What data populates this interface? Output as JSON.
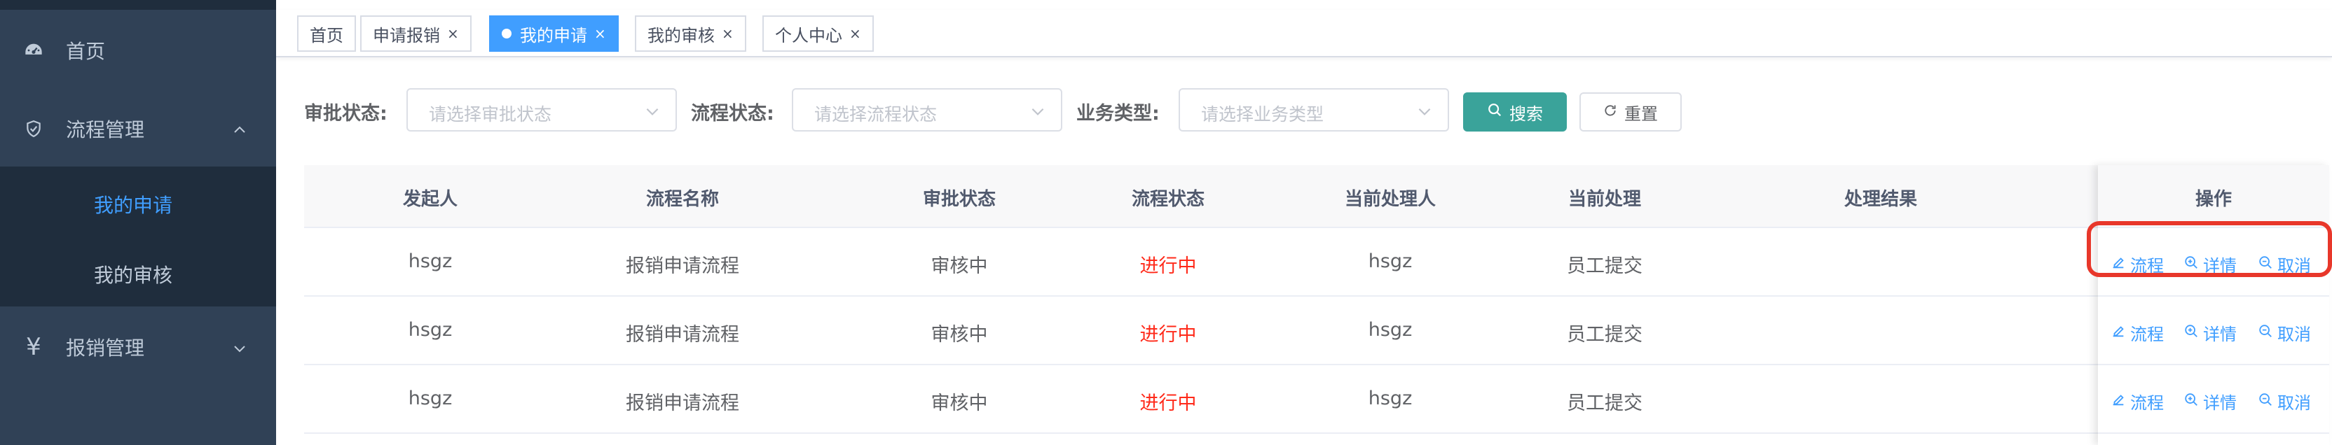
{
  "sidebar": {
    "items": [
      {
        "label": "首页",
        "icon": "dashboard-icon"
      },
      {
        "label": "流程管理",
        "icon": "shield-icon",
        "expanded": true,
        "children": [
          {
            "label": "我的申请",
            "active": true
          },
          {
            "label": "我的审核",
            "active": false
          }
        ]
      },
      {
        "label": "报销管理",
        "icon": "yen-icon",
        "expanded": false
      }
    ],
    "yen_symbol": "¥"
  },
  "tags": [
    {
      "label": "首页",
      "closable": false,
      "active": false
    },
    {
      "label": "申请报销",
      "closable": true,
      "active": false
    },
    {
      "label": "我的申请",
      "closable": true,
      "active": true
    },
    {
      "label": "我的审核",
      "closable": true,
      "active": false
    },
    {
      "label": "个人中心",
      "closable": true,
      "active": false
    }
  ],
  "tag_close": "×",
  "filters": {
    "approval_status": {
      "label": "审批状态:",
      "placeholder": "请选择审批状态"
    },
    "process_status": {
      "label": "流程状态:",
      "placeholder": "请选择流程状态"
    },
    "business_type": {
      "label": "业务类型:",
      "placeholder": "请选择业务类型"
    },
    "search_label": "搜索",
    "reset_label": "重置"
  },
  "table": {
    "columns": [
      "发起人",
      "流程名称",
      "审批状态",
      "流程状态",
      "当前处理人",
      "当前处理",
      "处理结果",
      "操作"
    ],
    "rows": [
      {
        "initiator": "hsgz",
        "process_name": "报销申请流程",
        "approval_status": "审核中",
        "process_status": "进行中",
        "handler": "hsgz",
        "current_step": "员工提交",
        "result": ""
      },
      {
        "initiator": "hsgz",
        "process_name": "报销申请流程",
        "approval_status": "审核中",
        "process_status": "进行中",
        "handler": "hsgz",
        "current_step": "员工提交",
        "result": ""
      },
      {
        "initiator": "hsgz",
        "process_name": "报销申请流程",
        "approval_status": "审核中",
        "process_status": "进行中",
        "handler": "hsgz",
        "current_step": "员工提交",
        "result": ""
      }
    ],
    "actions": {
      "flow": "流程",
      "detail": "详情",
      "cancel": "取消"
    }
  },
  "colors": {
    "sidebar_bg": "#304156",
    "submenu_bg": "#1f2d3d",
    "primary": "#409eff",
    "search_btn": "#3aa39a",
    "status_red": "#ff2a1a",
    "highlight": "#e8372a"
  }
}
